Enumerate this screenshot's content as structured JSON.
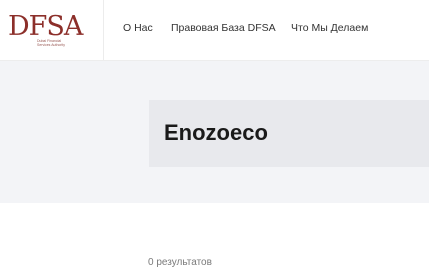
{
  "logo": {
    "text": "DFSA",
    "subtitle_lines": [
      "Dubai Financial",
      "Services Authority"
    ]
  },
  "nav": {
    "items": [
      "О Нас",
      "Правовая База DFSA",
      "Что Мы Делаем"
    ]
  },
  "search": {
    "value": "Enozoeco",
    "placeholder": ""
  },
  "results": {
    "summary": "0 результатов"
  },
  "colors": {
    "brand": "#8c2f2a",
    "band_background": "#f3f4f7",
    "search_box": "#e8e9ed"
  }
}
